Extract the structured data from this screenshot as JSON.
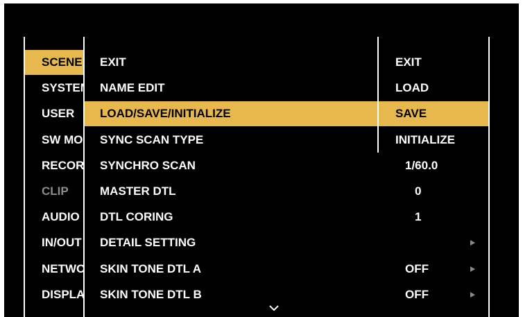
{
  "colors": {
    "highlight": "#e6b84d",
    "background": "#000000",
    "text": "#ffffff",
    "disabled": "#8c8c8c"
  },
  "left_menu": [
    {
      "label": "SCENE",
      "state": "selected"
    },
    {
      "label": "SYSTEM",
      "state": "normal"
    },
    {
      "label": "USER",
      "state": "normal"
    },
    {
      "label": "SW MODE",
      "state": "normal"
    },
    {
      "label": "RECORDING",
      "state": "normal"
    },
    {
      "label": "CLIP",
      "state": "disabled"
    },
    {
      "label": "AUDIO",
      "state": "normal"
    },
    {
      "label": "IN/OUT",
      "state": "normal"
    },
    {
      "label": "NETWORK",
      "state": "normal"
    },
    {
      "label": "DISPLAY",
      "state": "normal"
    }
  ],
  "menu": {
    "items": [
      {
        "label": "EXIT",
        "value": "",
        "has_submenu": false
      },
      {
        "label": "NAME EDIT",
        "value": "",
        "has_submenu": false
      },
      {
        "label": "LOAD/SAVE/INITIALIZE",
        "value": "",
        "has_submenu": false,
        "selected": true
      },
      {
        "label": "SYNC SCAN TYPE",
        "value": "",
        "has_submenu": false
      },
      {
        "label": "SYNCHRO SCAN",
        "value": "1/60.0",
        "has_submenu": false
      },
      {
        "label": "MASTER DTL",
        "value": "0",
        "has_submenu": false
      },
      {
        "label": "DTL CORING",
        "value": "1",
        "has_submenu": false
      },
      {
        "label": "DETAIL SETTING",
        "value": "",
        "has_submenu": true
      },
      {
        "label": "SKIN TONE DTL A",
        "value": "OFF",
        "has_submenu": true
      },
      {
        "label": "SKIN TONE DTL B",
        "value": "OFF",
        "has_submenu": true
      }
    ]
  },
  "options_popup": {
    "options": [
      "EXIT",
      "LOAD",
      "SAVE",
      "INITIALIZE"
    ],
    "selected": "SAVE"
  },
  "icons": {
    "scroll": "chevron-down-icon",
    "submenu": "triangle-right-icon"
  }
}
